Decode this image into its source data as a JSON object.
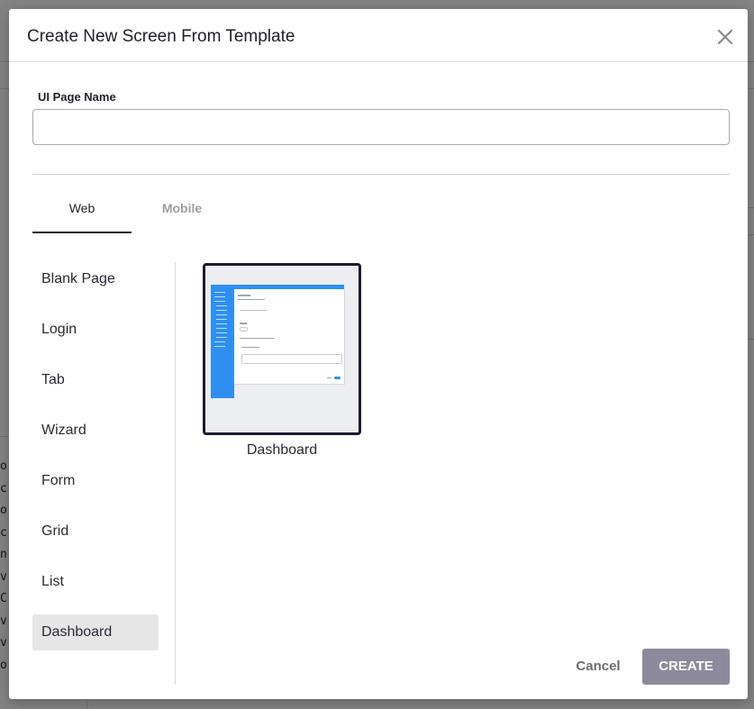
{
  "modal": {
    "title": "Create New Screen From Template",
    "close_icon": "close-icon"
  },
  "page_name": {
    "label": "UI Page Name",
    "value": "",
    "placeholder": ""
  },
  "tabs": [
    {
      "label": "Web",
      "active": true
    },
    {
      "label": "Mobile",
      "active": false
    }
  ],
  "categories": [
    {
      "label": "Blank Page",
      "active": false
    },
    {
      "label": "Login",
      "active": false
    },
    {
      "label": "Tab",
      "active": false
    },
    {
      "label": "Wizard",
      "active": false
    },
    {
      "label": "Form",
      "active": false
    },
    {
      "label": "Grid",
      "active": false
    },
    {
      "label": "List",
      "active": false
    },
    {
      "label": "Dashboard",
      "active": true
    }
  ],
  "templates": [
    {
      "caption": "Dashboard",
      "selected": true
    }
  ],
  "footer": {
    "cancel_label": "Cancel",
    "create_label": "CREATE"
  },
  "colors": {
    "accent_dark": "#1c1b30",
    "create_button": "#8c8a9c",
    "thumbnail_blue": "#2f8ff0"
  }
}
